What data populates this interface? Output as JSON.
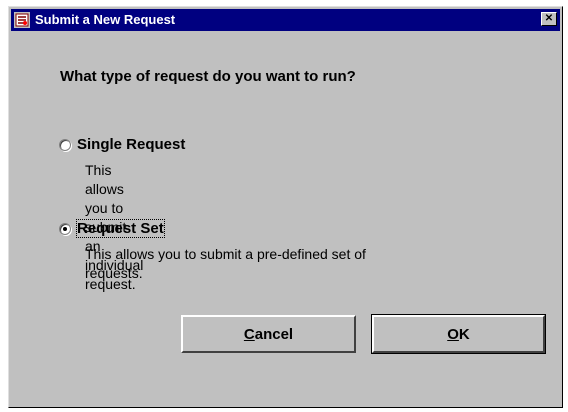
{
  "window": {
    "title": "Submit a New Request",
    "close_glyph": "✕"
  },
  "dialog": {
    "question": "What type of request do you want to run?",
    "options": [
      {
        "label": "Single Request",
        "description": "This allows you to submit an individual request.",
        "selected": false
      },
      {
        "label": "Request Set",
        "description_line1": "This allows you to submit a pre-defined set of",
        "description_line2": "requests.",
        "selected": true
      }
    ]
  },
  "buttons": {
    "cancel_label_rest": "ancel",
    "cancel_mnemonic": "C",
    "ok_label_rest": "K",
    "ok_mnemonic": "O"
  }
}
